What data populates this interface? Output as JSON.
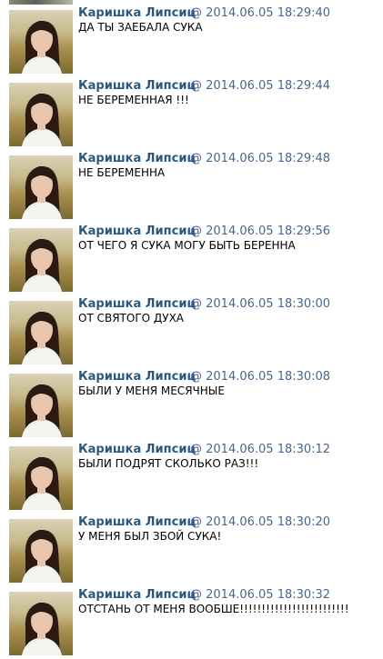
{
  "messages": [
    {
      "author": "Каришка Липсиц",
      "timestamp": "@ 2014.06.05 18:29:40",
      "text": "ДА ТЫ ЗАЕБАЛА СУКА"
    },
    {
      "author": "Каришка Липсиц",
      "timestamp": "@ 2014.06.05 18:29:44",
      "text": "НЕ БЕРЕМЕННАЯ !!!"
    },
    {
      "author": "Каришка Липсиц",
      "timestamp": "@ 2014.06.05 18:29:48",
      "text": "НЕ БЕРЕМЕННА"
    },
    {
      "author": "Каришка Липсиц",
      "timestamp": "@ 2014.06.05 18:29:56",
      "text": "ОТ ЧЕГО Я СУКА МОГУ БЫТЬ БЕРЕННА"
    },
    {
      "author": "Каришка Липсиц",
      "timestamp": "@ 2014.06.05 18:30:00",
      "text": "ОТ СВЯТОГО ДУХА"
    },
    {
      "author": "Каришка Липсиц",
      "timestamp": "@ 2014.06.05 18:30:08",
      "text": "БЫЛИ У МЕНЯ МЕСЯЧНЫЕ"
    },
    {
      "author": "Каришка Липсиц",
      "timestamp": "@ 2014.06.05 18:30:12",
      "text": "БЫЛИ ПОДРЯТ СКОЛЬКО РАЗ!!!"
    },
    {
      "author": "Каришка Липсиц",
      "timestamp": "@ 2014.06.05 18:30:20",
      "text": "У МЕНЯ БЫЛ ЗБОЙ СУКА!"
    },
    {
      "author": "Каришка Липсиц",
      "timestamp": "@ 2014.06.05 18:30:32",
      "text": "ОТСТАНЬ ОТ МЕНЯ ВООБШЕ!!!!!!!!!!!!!!!!!!!!!!!!!"
    }
  ],
  "colors": {
    "author": "#2b587a",
    "timestamp": "#45688e",
    "text": "#000000",
    "background": "#ffffff"
  }
}
